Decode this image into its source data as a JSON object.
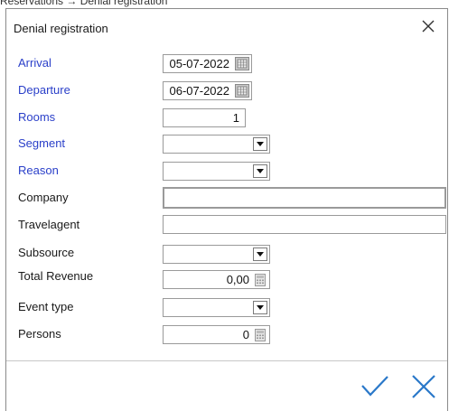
{
  "breadcrumb": "Reservations → Denial registration",
  "dialog": {
    "title": "Denial registration",
    "close_icon": "close-icon",
    "accent_color": "#2a3fc9"
  },
  "fields": {
    "arrival": {
      "label": "Arrival",
      "value": "05-07-2022"
    },
    "departure": {
      "label": "Departure",
      "value": "06-07-2022"
    },
    "rooms": {
      "label": "Rooms",
      "value": "1"
    },
    "segment": {
      "label": "Segment",
      "value": ""
    },
    "reason": {
      "label": "Reason",
      "value": ""
    },
    "company": {
      "label": "Company",
      "value": ""
    },
    "travelagent": {
      "label": "Travelagent",
      "value": ""
    },
    "subsource": {
      "label": "Subsource",
      "value": ""
    },
    "total_revenue": {
      "label": "Total Revenue",
      "value": "0,00"
    },
    "event_type": {
      "label": "Event type",
      "value": ""
    },
    "persons": {
      "label": "Persons",
      "value": "0"
    }
  },
  "footer": {
    "ok_icon": "checkmark-icon",
    "cancel_icon": "close-icon"
  }
}
